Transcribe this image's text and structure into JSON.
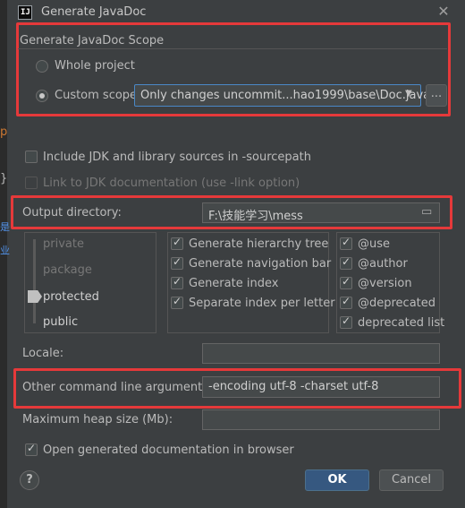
{
  "window": {
    "title": "Generate JavaDoc",
    "app_icon": "IJ"
  },
  "background_strip": [
    "p",
    "}",
    "是",
    "业"
  ],
  "scope": {
    "heading": "Generate JavaDoc Scope",
    "whole_project_label": "Whole project",
    "whole_project_checked": false,
    "custom_scope_label": "Custom scope",
    "custom_scope_checked": true,
    "custom_scope_value": "Only changes uncommit...hao1999\\base\\Doc.java",
    "browse_label": "..."
  },
  "include_jdk": {
    "label": "Include JDK and library sources in -sourcepath",
    "checked": false
  },
  "link_jdk": {
    "label": "Link to JDK documentation (use -link option)",
    "checked": false,
    "enabled": false
  },
  "output": {
    "label": "Output directory:",
    "value": "F:\\技能学习\\mess"
  },
  "visibility": {
    "levels": [
      "private",
      "package",
      "protected",
      "public"
    ],
    "selected": "protected"
  },
  "generate_options": [
    {
      "label": "Generate hierarchy tree",
      "checked": true
    },
    {
      "label": "Generate navigation bar",
      "checked": true
    },
    {
      "label": "Generate index",
      "checked": true
    },
    {
      "label": "Separate index per letter",
      "checked": true
    }
  ],
  "tags": [
    {
      "label": "@use",
      "checked": true
    },
    {
      "label": "@author",
      "checked": true
    },
    {
      "label": "@version",
      "checked": true
    },
    {
      "label": "@deprecated",
      "checked": true
    },
    {
      "label": "deprecated list",
      "checked": true
    }
  ],
  "locale": {
    "label": "Locale:",
    "value": ""
  },
  "other_args": {
    "label": "Other command line arguments:",
    "value": "-encoding utf-8 -charset utf-8"
  },
  "heap": {
    "label": "Maximum heap size (Mb):",
    "value": ""
  },
  "open_browser": {
    "label": "Open generated documentation in browser",
    "checked": true
  },
  "buttons": {
    "help": "?",
    "ok": "OK",
    "cancel": "Cancel"
  },
  "colors": {
    "highlight_border": "#e5393a",
    "primary_button": "#365880",
    "background": "#3c3f41"
  }
}
